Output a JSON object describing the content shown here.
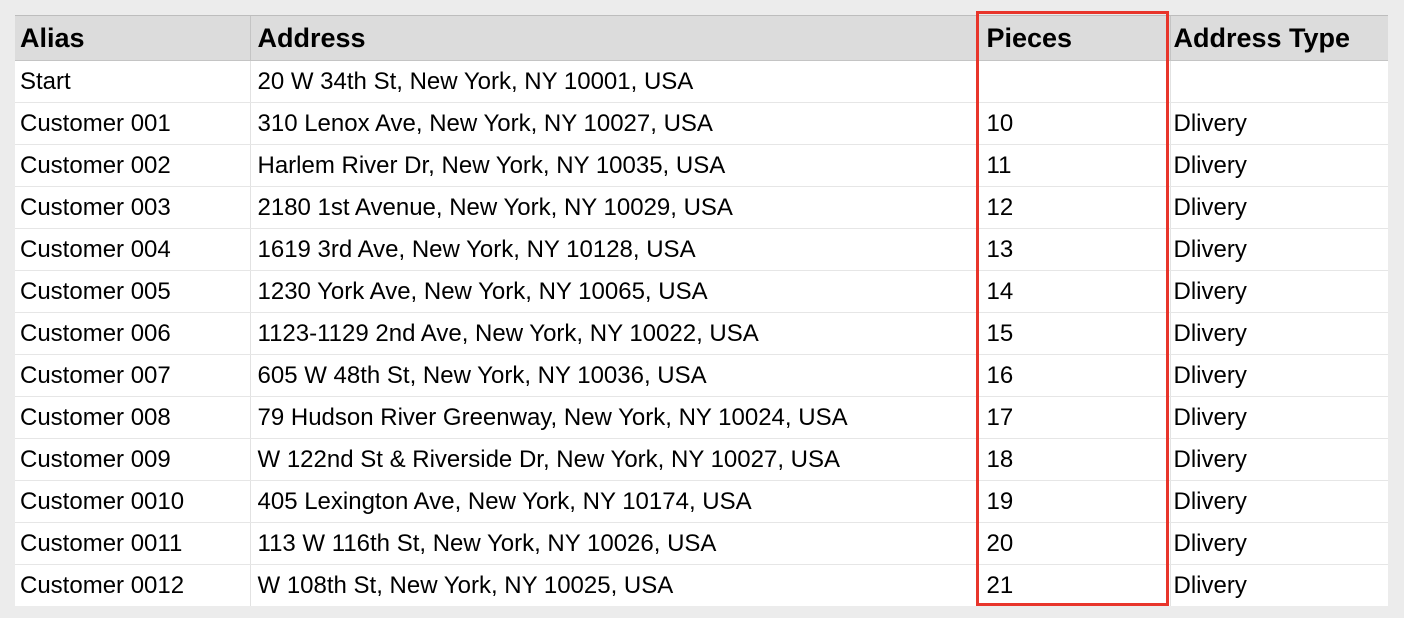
{
  "table": {
    "columns": [
      "Alias",
      "Address",
      "Pieces",
      "Address Type"
    ],
    "rows": [
      {
        "alias": "Start",
        "address": "20 W 34th St, New York, NY 10001, USA",
        "pieces": "",
        "type": ""
      },
      {
        "alias": "Customer 001",
        "address": "310 Lenox Ave, New York, NY 10027, USA",
        "pieces": "10",
        "type": "Dlivery"
      },
      {
        "alias": "Customer 002",
        "address": "Harlem River Dr, New York, NY 10035, USA",
        "pieces": "11",
        "type": "Dlivery"
      },
      {
        "alias": "Customer 003",
        "address": "2180 1st Avenue, New York, NY 10029, USA",
        "pieces": "12",
        "type": "Dlivery"
      },
      {
        "alias": "Customer 004",
        "address": "1619 3rd Ave, New York, NY 10128, USA",
        "pieces": "13",
        "type": "Dlivery"
      },
      {
        "alias": "Customer 005",
        "address": "1230 York Ave, New York, NY 10065, USA",
        "pieces": "14",
        "type": "Dlivery"
      },
      {
        "alias": "Customer 006",
        "address": "1123-1129 2nd Ave, New York, NY 10022, USA",
        "pieces": "15",
        "type": "Dlivery"
      },
      {
        "alias": "Customer 007",
        "address": "605 W 48th St, New York, NY 10036, USA",
        "pieces": "16",
        "type": "Dlivery"
      },
      {
        "alias": "Customer 008",
        "address": "79 Hudson River Greenway, New York, NY 10024, USA",
        "pieces": "17",
        "type": "Dlivery"
      },
      {
        "alias": "Customer 009",
        "address": "W 122nd St & Riverside Dr, New York, NY 10027, USA",
        "pieces": "18",
        "type": "Dlivery"
      },
      {
        "alias": "Customer 0010",
        "address": "405 Lexington Ave, New York, NY 10174, USA",
        "pieces": "19",
        "type": "Dlivery"
      },
      {
        "alias": "Customer 0011",
        "address": "113 W 116th St, New York, NY 10026, USA",
        "pieces": "20",
        "type": "Dlivery"
      },
      {
        "alias": "Customer 0012",
        "address": "W 108th St, New York, NY 10025, USA",
        "pieces": "21",
        "type": "Dlivery"
      }
    ]
  },
  "highlight": {
    "column": "Pieces",
    "color": "#e8352b"
  }
}
